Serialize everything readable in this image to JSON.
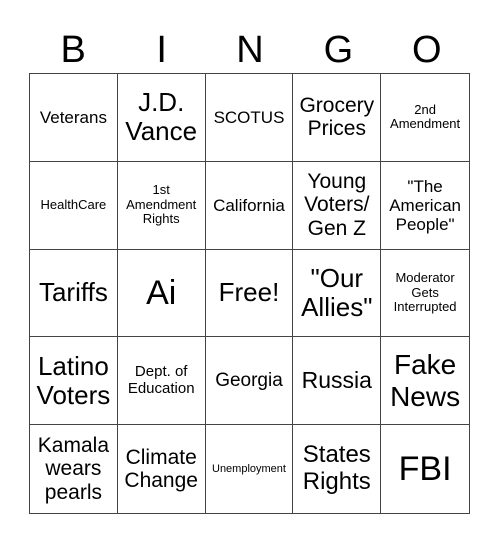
{
  "card": {
    "header": [
      "B",
      "I",
      "N",
      "G",
      "O"
    ],
    "cells": [
      [
        "Veterans",
        "J.D. Vance",
        "SCOTUS",
        "Grocery Prices",
        "2nd Amendment"
      ],
      [
        "HealthCare",
        "1st Amendment Rights",
        "California",
        "Young Voters/ Gen Z",
        "\"The American People\""
      ],
      [
        "Tariffs",
        "Ai",
        "Free!",
        "\"Our Allies\"",
        "Moderator Gets Interrupted"
      ],
      [
        "Latino Voters",
        "Dept. of Education",
        "Georgia",
        "Russia",
        "Fake News"
      ],
      [
        "Kamala wears pearls",
        "Climate Change",
        "Unemployment",
        "States Rights",
        "FBI"
      ]
    ],
    "free_space": "Free!"
  }
}
